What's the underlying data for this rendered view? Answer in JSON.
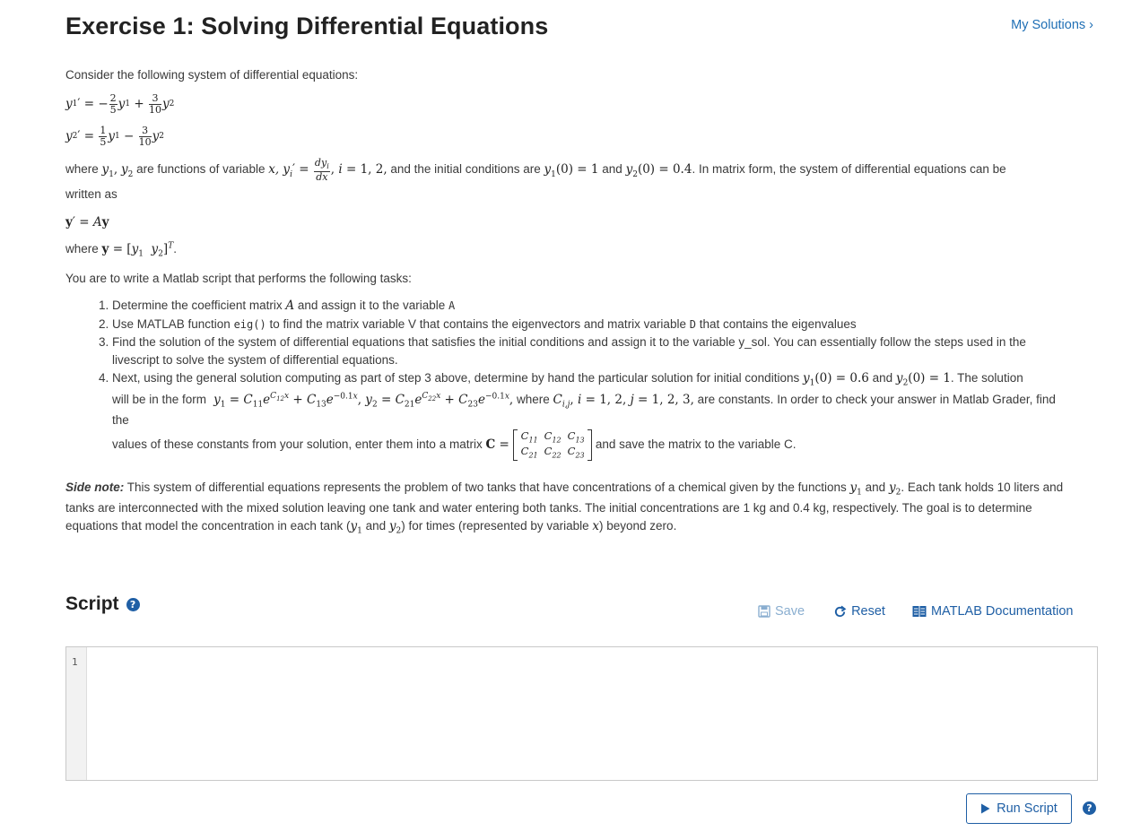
{
  "header": {
    "title": "Exercise 1: Solving Differential Equations",
    "my_solutions": "My Solutions ›"
  },
  "problem": {
    "intro": "Consider the following system of differential equations:",
    "where_1": "where",
    "where_2": "are functions of variable",
    "where_3": "and the initial conditions are",
    "where_4": "and",
    "where_5": ". In matrix form, the system of differential equations can be",
    "written_as": "written as",
    "where_y": "where",
    "task_intro": "You are to write a Matlab script that performs the following tasks:",
    "tasks": {
      "t1a": "Determine the coefficient matrix",
      "t1b": "and assign it to the variable",
      "t1c": "A",
      "t2a": "Use MATLAB function",
      "t2b": "eig()",
      "t2c": "to find the matrix variable V that contains the eigenvectors and matrix variable",
      "t2d": "D",
      "t2e": "that contains the eigenvalues",
      "t3": "Find the solution of the system of differential equations that satisfies the initial conditions and assign it to the variable y_sol. You can essentially follow the steps used in the livescript to solve the system of differential equations.",
      "t4a": "Next, using the general solution computing as part of step 3 above,  determine by hand the particular solution for initial conditions",
      "t4b": "and",
      "t4c": ". The solution",
      "t4d": "will be in the form",
      "t4e": "where",
      "t4f": "are constants. In order to check your answer in Matlab Grader, find the",
      "t4g": "values of these constants from your solution, enter them into a matrix",
      "t4h": "and save the matrix to the variable C."
    },
    "side_note_label": "Side note:",
    "side_note_1": "This system of differential equations represents the problem of two tanks that have concentrations of a chemical given by the functions",
    "side_note_2": "and",
    "side_note_3": ". Each tank holds 10 liters and tanks are interconnected with the mixed solution leaving one tank and water entering both tanks. The initial concentrations are 1 kg and 0.4 kg, respectively. The goal is to determine equations that model the concentration in each tank (",
    "side_note_4": "and",
    "side_note_5": ") for times (represented by variable",
    "side_note_6": ") beyond zero."
  },
  "script": {
    "title": "Script",
    "save_label": "Save",
    "reset_label": "Reset",
    "docs_label": "MATLAB Documentation",
    "line_number": "1",
    "code": "",
    "run_label": "Run Script"
  }
}
